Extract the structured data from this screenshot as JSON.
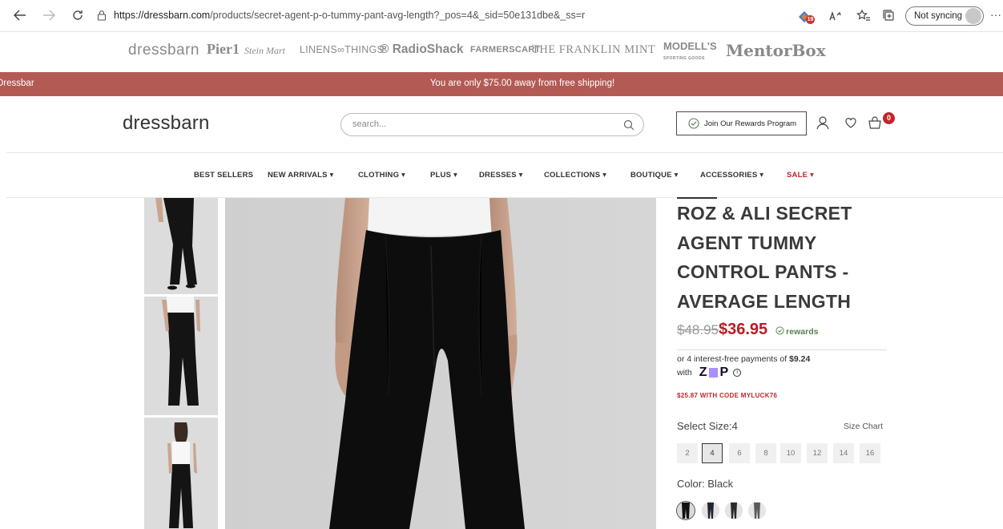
{
  "browser": {
    "url_host": "https://dressbarn.com",
    "url_path": "/products/secret-agent-p-o-tummy-pant-avg-length?_pos=4&_sid=50e131dbe&_ss=r",
    "extension_badge": "19",
    "sync_label": "Not syncing",
    "more_label": "···"
  },
  "brands": [
    {
      "label": "dressbarn"
    },
    {
      "label": "Pier1"
    },
    {
      "label": "Stein Mart"
    },
    {
      "label": "LINENS∞THINGS"
    },
    {
      "label": "® RadioShack"
    },
    {
      "label": "FARMERSCART"
    },
    {
      "label": "THE FRANKLIN MINT"
    },
    {
      "label": "MODELL'S"
    },
    {
      "label": "MentorBox"
    }
  ],
  "promo": {
    "left_label": "Dressbar",
    "message": "You are only $75.00 away from free shipping!"
  },
  "header": {
    "logo": "dressbarn",
    "search_placeholder": "search...",
    "rewards_button": "Join Our Rewards Program",
    "cart_count": "0"
  },
  "nav": [
    {
      "label": "BEST SELLERS"
    },
    {
      "label": "NEW ARRIVALS ▾"
    },
    {
      "label": "CLOTHING ▾"
    },
    {
      "label": "PLUS ▾"
    },
    {
      "label": "DRESSES ▾"
    },
    {
      "label": "COLLECTIONS ▾"
    },
    {
      "label": "BOUTIQUE ▾"
    },
    {
      "label": "ACCESSORIES ▾"
    },
    {
      "label": "SALE ▾"
    }
  ],
  "product": {
    "title": "ROZ & ALI SECRET AGENT TUMMY CONTROL PANTS - AVERAGE LENGTH",
    "price_old": "$48.95",
    "price_new": "$36.95",
    "rewards_label": "rewards",
    "installments_text": "or 4 interest-free payments of ",
    "installment_amount": "$9.24",
    "with_label": "with",
    "zip_z": "Z",
    "zip_p": "P",
    "promo_code_text": "$25.87 WITH CODE MYLUCK76",
    "size_label": "Select Size:4",
    "size_chart_label": "Size Chart",
    "sizes": [
      "2",
      "4",
      "6",
      "8",
      "10",
      "12",
      "14",
      "16"
    ],
    "selected_size": "4",
    "color_label": "Color: Black",
    "swatch_count": 4
  },
  "colors": {
    "promo_bar": "#b35a55",
    "sale_red": "#c0262b",
    "price_red": "#b71c22",
    "rewards_green": "#5a7f53",
    "zip_purple": "#aa8fff"
  }
}
